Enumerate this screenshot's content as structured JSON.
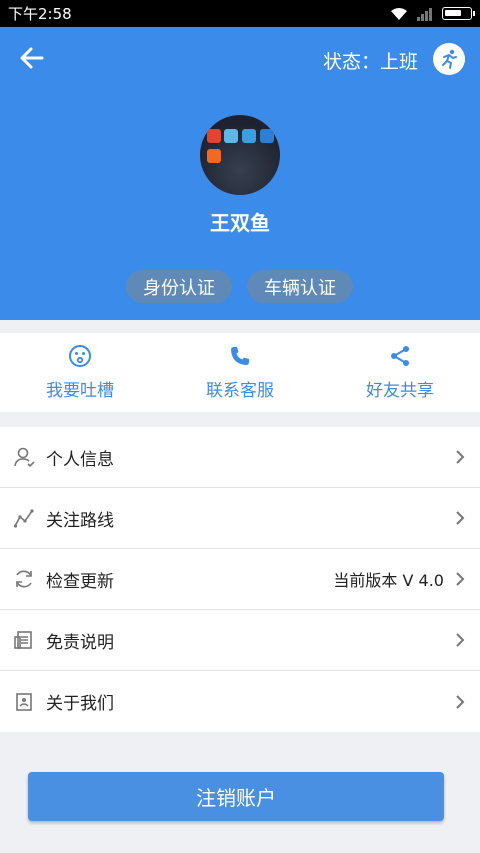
{
  "statusbar": {
    "time": "下午2:58"
  },
  "header": {
    "status_label": "状态：上班",
    "username": "王双鱼",
    "cert_buttons": [
      "身份认证",
      "车辆认证"
    ]
  },
  "actions": [
    {
      "label": "我要吐槽",
      "icon": "complaint-face-icon"
    },
    {
      "label": "联系客服",
      "icon": "phone-icon"
    },
    {
      "label": "好友共享",
      "icon": "share-icon"
    }
  ],
  "menu": [
    {
      "label": "个人信息",
      "icon": "user-icon",
      "value": ""
    },
    {
      "label": "关注路线",
      "icon": "route-icon",
      "value": ""
    },
    {
      "label": "检查更新",
      "icon": "refresh-icon",
      "value": "当前版本  V 4.0"
    },
    {
      "label": "免责说明",
      "icon": "document-icon",
      "value": ""
    },
    {
      "label": "关于我们",
      "icon": "info-card-icon",
      "value": ""
    }
  ],
  "logout_label": "注销账户",
  "colors": {
    "primary": "#3b8bea",
    "cert_bg": "#5f8ab8",
    "button": "#4a90e2"
  }
}
